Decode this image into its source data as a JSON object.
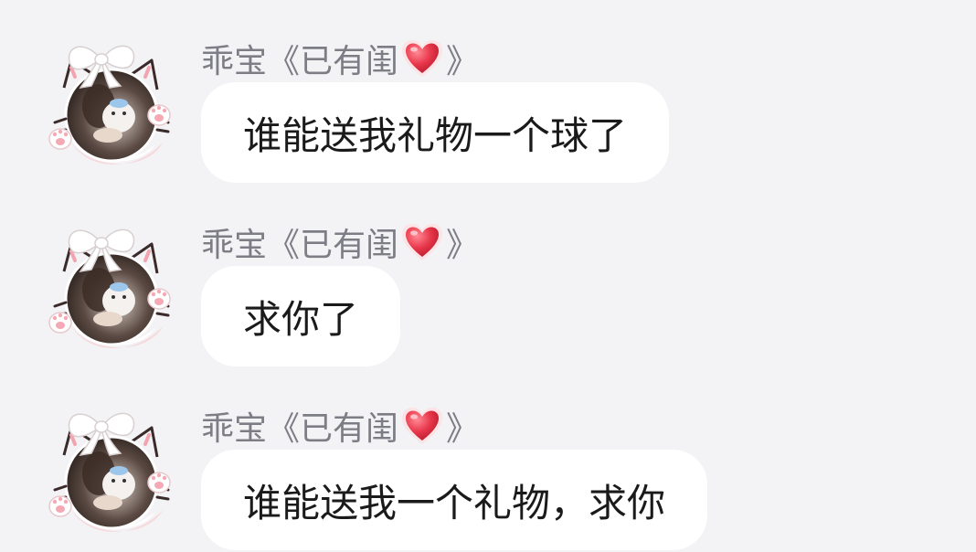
{
  "messages": [
    {
      "sender": {
        "name_prefix": "乖宝《已有闺",
        "name_suffix": "》"
      },
      "text": "谁能送我礼物一个球了"
    },
    {
      "sender": {
        "name_prefix": "乖宝《已有闺",
        "name_suffix": "》"
      },
      "text": "求你了"
    },
    {
      "sender": {
        "name_prefix": "乖宝《已有闺",
        "name_suffix": "》"
      },
      "text": "谁能送我一个礼物，求你"
    }
  ],
  "icons": {
    "avatar": "cat-ear-bow-avatar-icon",
    "heart": "heart-emoji-icon"
  },
  "colors": {
    "background": "#f3f3f6",
    "bubble": "#ffffff",
    "name_text": "#7d7d85",
    "message_text": "#1a1a1a",
    "heart": "#e8364a"
  }
}
